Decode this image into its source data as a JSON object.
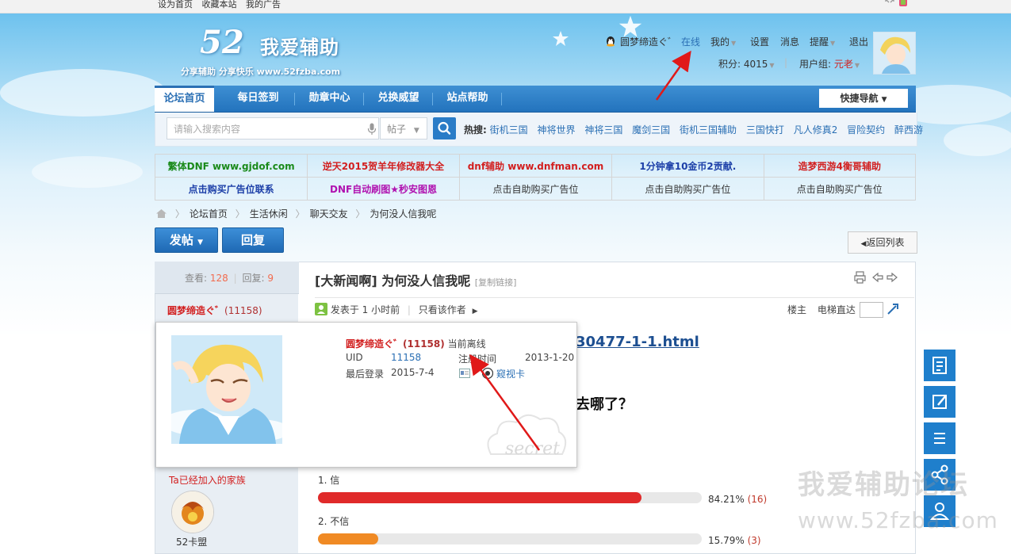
{
  "topbar": {
    "links": [
      "设为首页",
      "收藏本站",
      "我的广告"
    ]
  },
  "logo": {
    "number": "52",
    "title": "我爱辅助",
    "slogan": "分享辅助  分享快乐  www.52fzba.com"
  },
  "user": {
    "name": "圆梦缔造ぐ゛",
    "status": "在线",
    "menu": [
      "我的",
      "设置",
      "消息",
      "提醒",
      "退出"
    ],
    "points_label": "积分: 4015",
    "group_label": "用户组:",
    "group_value": "元老"
  },
  "nav": {
    "items": [
      "论坛首页",
      "每日签到",
      "勋章中心",
      "兑换威望",
      "站点帮助"
    ],
    "quick_nav": "快捷导航"
  },
  "search": {
    "placeholder": "请输入搜索内容",
    "type": "帖子",
    "hot_label": "热搜:",
    "hot_words": [
      "街机三国",
      "神将世界",
      "神将三国",
      "魔剑三国",
      "街机三国辅助",
      "三国快打",
      "凡人修真2",
      "冒险契约",
      "醉西游"
    ]
  },
  "ads": {
    "row1": [
      "繁体DNF www.gjdof.com",
      "逆天2015贺羊年修改器大全",
      "dnf辅助 www.dnfman.com",
      "1分钟拿10金币2贡献.",
      "造梦西游4衡哥辅助"
    ],
    "row2": [
      "点击购买广告位联系",
      "DNF自动刷图★秒安图恩",
      "点击自助购买广告位",
      "点击自助购买广告位",
      "点击自助购买广告位"
    ],
    "colors1": [
      "#1a8a1a",
      "#d21f1f",
      "#d21f1f",
      "#1c3fa8",
      "#d21f1f"
    ],
    "colors2": [
      "#1c3fa8",
      "#b012b0",
      "#333333",
      "#333333",
      "#333333"
    ]
  },
  "breadcrumb": [
    "论坛首页",
    "生活休闲",
    "聊天交友",
    "为何没人信我呢"
  ],
  "actions": {
    "post": "发帖",
    "reply": "回复",
    "back": "返回列表"
  },
  "thread": {
    "views_label": "查看:",
    "views": "128",
    "replies_label": "回复:",
    "replies": "9",
    "title": "[大新闻啊] 为何没人信我呢",
    "copy_link": "[复制链接]",
    "author": "圆梦缔造ぐ゛",
    "author_uid_paren": "(11158)",
    "posted": "发表于 1 小时前",
    "only_author": "只看该作者",
    "floor_owner": "楼主",
    "elevator": "电梯直达",
    "link_fragment": "30477-1-1.html",
    "question_fragment": "去哪了？",
    "family_text": "Ta已经加入的家族",
    "family_name": "52卡盟"
  },
  "profile_card": {
    "name": "圆梦缔造ぐ゛",
    "uid_paren": "(11158)",
    "status": "当前离线",
    "uid_label": "UID",
    "uid": "11158",
    "reg_label": "注册时间",
    "reg_date": "2013-1-20",
    "last_label": "最后登录",
    "last_date": "2015-7-4",
    "peek": "窥视卡",
    "watermark": "secret"
  },
  "poll": [
    {
      "label": "1.  信",
      "fraction": 0.8421,
      "pct": "84.21%",
      "count": "(16)",
      "color": "#e02a2a"
    },
    {
      "label": "2.  不信",
      "fraction": 0.1579,
      "pct": "15.79%",
      "count": "(3)",
      "color": "#f08a24"
    }
  ],
  "watermark": {
    "line1": "我爱辅助论坛",
    "line2": "www.52fzba.com"
  }
}
